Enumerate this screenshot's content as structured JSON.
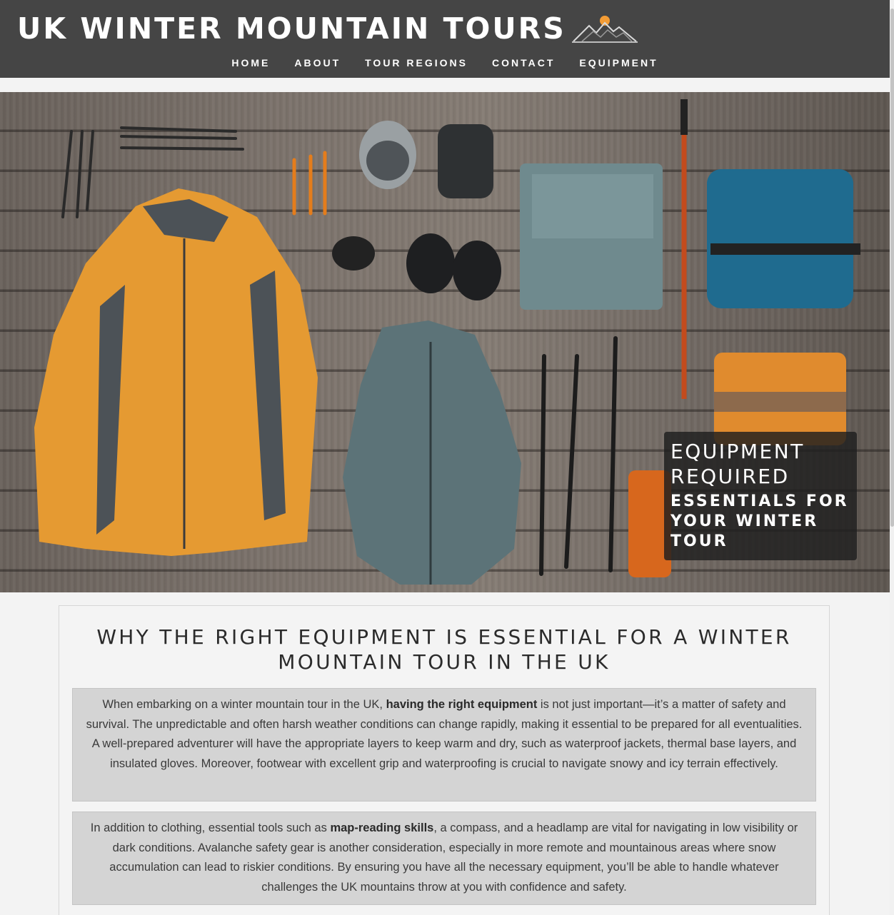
{
  "site": {
    "title": "UK WINTER MOUNTAIN TOURS",
    "logo_icon": "mountain-sun-icon",
    "accent_color": "#f39c35",
    "header_bg": "#454545"
  },
  "nav": [
    {
      "label": "HOME"
    },
    {
      "label": "ABOUT"
    },
    {
      "label": "TOUR REGIONS"
    },
    {
      "label": "CONTACT"
    },
    {
      "label": "EQUIPMENT"
    }
  ],
  "hero": {
    "image_alt": "Winter mountain equipment laid out on wooden boards",
    "heading": "EQUIPMENT REQUIRED",
    "subheading": "ESSENTIALS FOR YOUR WINTER TOUR"
  },
  "content": {
    "heading": "WHY THE RIGHT EQUIPMENT IS ESSENTIAL FOR A WINTER MOUNTAIN TOUR IN THE UK",
    "p1": {
      "pre": "When embarking on a winter mountain tour in the UK, ",
      "bold": "having the right equipment",
      "post": " is not just important—it’s a matter of safety and survival. The unpredictable and often harsh weather conditions can change rapidly, making it essential to be prepared for all eventualities. A well-prepared adventurer will have the appropriate layers to keep warm and dry, such as waterproof jackets, thermal base layers, and insulated gloves. Moreover, footwear with excellent grip and waterproofing is crucial to navigate snowy and icy terrain effectively."
    },
    "p2": {
      "pre": "In addition to clothing, essential tools such as ",
      "bold": "map-reading skills",
      "post": ", a compass, and a headlamp are vital for navigating in low visibility or dark conditions. Avalanche safety gear is another consideration, especially in more remote and mountainous areas where snow accumulation can lead to riskier conditions. By ensuring you have all the necessary equipment, you’ll be able to handle whatever challenges the UK mountains throw at you with confidence and safety."
    }
  }
}
